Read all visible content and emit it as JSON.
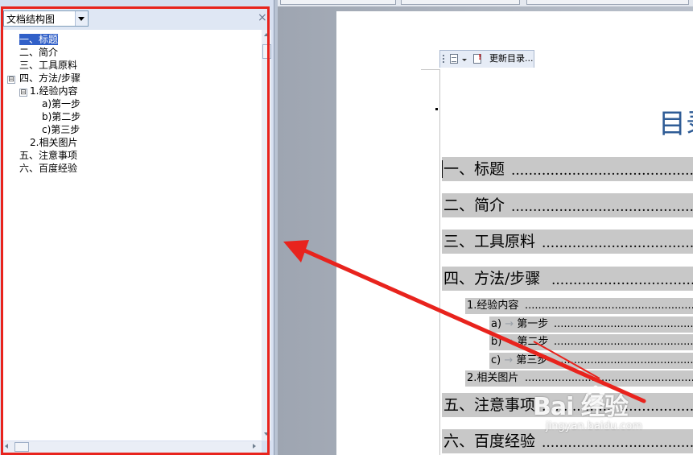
{
  "navigation_pane": {
    "view_selector": "文档结构图",
    "close_glyph": "×",
    "items": [
      {
        "label": "一、标题",
        "selected": true
      },
      {
        "label": "二、简介"
      },
      {
        "label": "三、工具原料"
      },
      {
        "label": "四、方法/步骤",
        "toggle": "⊟"
      },
      {
        "label": "1.经验内容",
        "toggle": "⊟"
      },
      {
        "label": "a)第一步"
      },
      {
        "label": "b)第二步"
      },
      {
        "label": "c)第三步"
      },
      {
        "label": "2.相关图片"
      },
      {
        "label": "五、注意事项"
      },
      {
        "label": "六、百度经验"
      }
    ]
  },
  "document": {
    "toc_control": {
      "update_label": "更新目录..."
    },
    "toc_title": "目录",
    "toc_entries": [
      {
        "text": "一、标题",
        "level": 1
      },
      {
        "text": "二、简介",
        "level": 1
      },
      {
        "text": "三、工具原料",
        "level": 1
      },
      {
        "text": "四、方法/步骤",
        "level": 1
      },
      {
        "text": "1.经验内容",
        "level": 2
      },
      {
        "text": "a)",
        "level": 3,
        "arrow": "→",
        "step": "第一步"
      },
      {
        "text": "b)",
        "level": 3,
        "arrow": "→",
        "step": "第二步"
      },
      {
        "text": "c)",
        "level": 3,
        "arrow": "→",
        "step": "第三步"
      },
      {
        "text": "2.相关图片",
        "level": 2
      },
      {
        "text": "五、注意事项",
        "level": 1
      },
      {
        "text": "六、百度经验",
        "level": 1
      }
    ],
    "leader_dots": "..............................................................................................."
  },
  "annotation": {
    "highlight_color": "#e8231d",
    "arrow_color": "#e8231d"
  },
  "watermark": {
    "logo_text": "Bai  经验",
    "url": "jingyan.baidu.com"
  }
}
